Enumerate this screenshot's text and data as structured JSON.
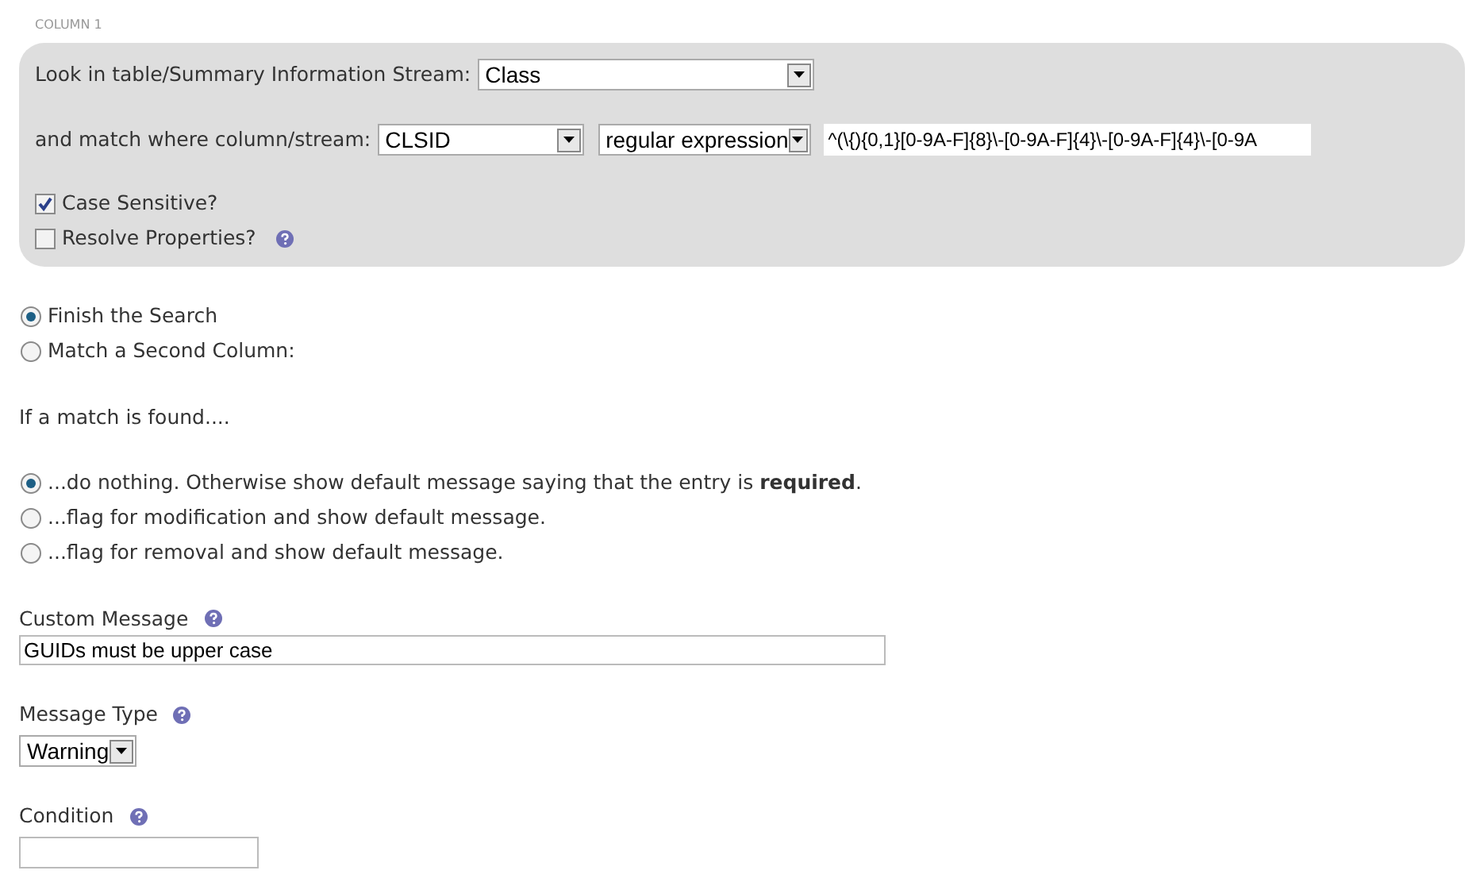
{
  "section_label": "COLUMN 1",
  "lookup": {
    "table_label": "Look in table/Summary Information Stream:",
    "table_value": "Class",
    "column_label": "and match where column/stream:",
    "column_value": "CLSID",
    "operator_value": "regular expression",
    "pattern_value": "^(\\{){0,1}[0-9A-F]{8}\\-[0-9A-F]{4}\\-[0-9A-F]{4}\\-[0-9A",
    "checkboxes": [
      {
        "label": "Case Sensitive?",
        "checked": true,
        "help": false
      },
      {
        "label": "Resolve Properties?",
        "checked": false,
        "help": true
      }
    ]
  },
  "next_step": [
    {
      "label": "Finish the Search",
      "selected": true
    },
    {
      "label": "Match a Second Column:",
      "selected": false
    }
  ],
  "match_heading": "If a match is found....",
  "match_actions": [
    {
      "label": "...do nothing. Otherwise show default message saying that the entry is **required**.",
      "selected": true
    },
    {
      "label": "...flag for modification and show default message.",
      "selected": false
    },
    {
      "label": "...flag for removal and show default message.",
      "selected": false
    }
  ],
  "custom_message": {
    "label": "Custom Message",
    "value": "GUIDs must be upper case"
  },
  "message_type": {
    "label": "Message Type",
    "value": "Warning"
  },
  "condition": {
    "label": "Condition"
  }
}
